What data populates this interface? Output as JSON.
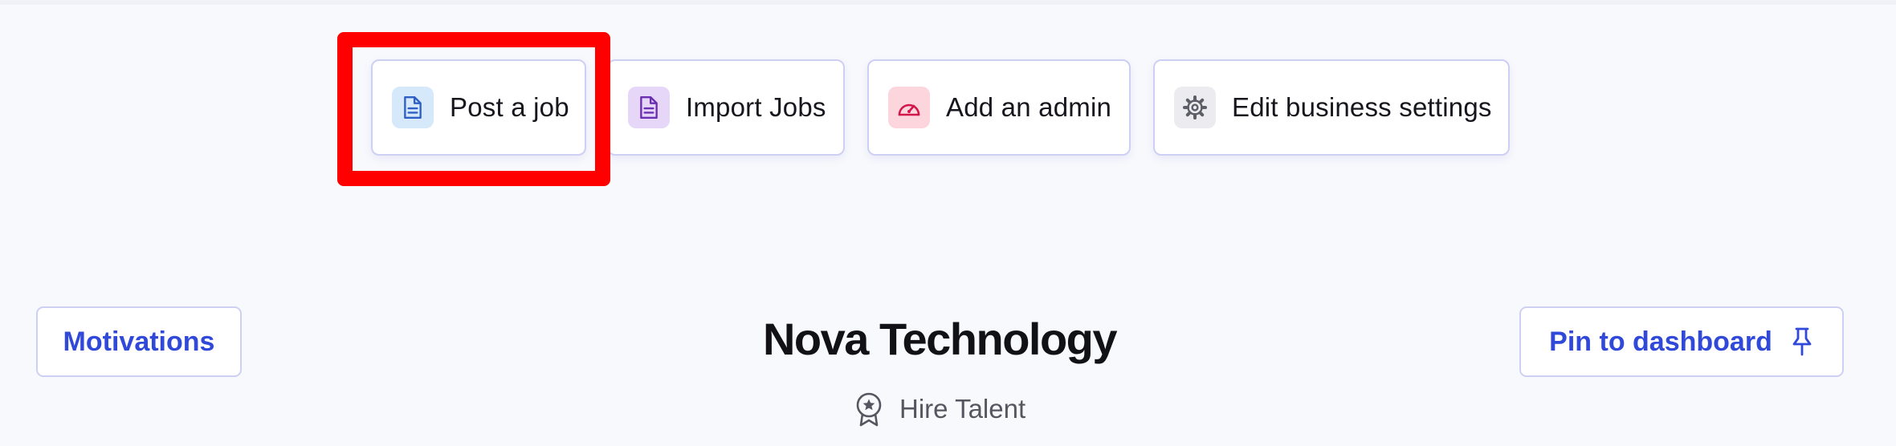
{
  "quick_actions": [
    {
      "label": "Post a job",
      "icon": "document-icon",
      "icon_bg": "#d6e9fb",
      "icon_color": "#2d5fc4"
    },
    {
      "label": "Import Jobs",
      "icon": "document-icon",
      "icon_bg": "#e6d7f8",
      "icon_color": "#6b2fb3"
    },
    {
      "label": "Add an admin",
      "icon": "gauge-icon",
      "icon_bg": "#fdd5dd",
      "icon_color": "#d3174a"
    },
    {
      "label": "Edit business settings",
      "icon": "gear-icon",
      "icon_bg": "#ececf0",
      "icon_color": "#5d5e67"
    }
  ],
  "highlighted_action": "Post a job",
  "motivations_label": "Motivations",
  "pin_label": "Pin to dashboard",
  "company": {
    "name": "Nova Technology",
    "tagline": "Hire Talent",
    "tagline_icon": "award-badge-icon"
  },
  "colors": {
    "page_bg": "#f8f9fd",
    "accent": "#3149d9",
    "card_border": "#cdd0f2",
    "highlight": "#ff0000"
  }
}
